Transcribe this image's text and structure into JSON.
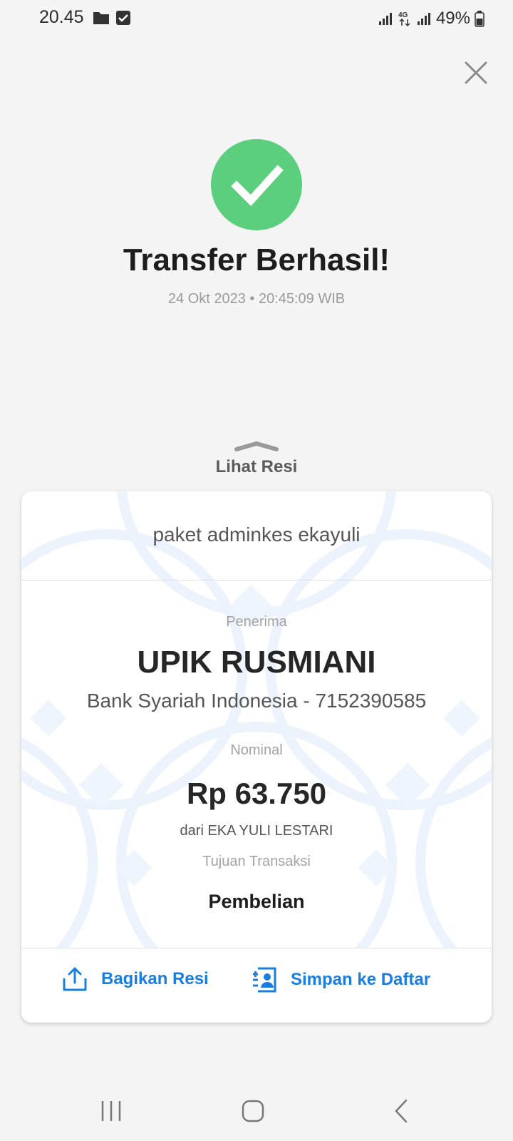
{
  "status_bar": {
    "time": "20.45",
    "battery": "49%"
  },
  "header": {
    "title": "Transfer Berhasil!",
    "datetime": "24 Okt 2023 • 20:45:09 WIB"
  },
  "receipt_toggle": {
    "label": "Lihat Resi"
  },
  "receipt": {
    "note": "paket adminkes ekayuli",
    "recipient_label": "Penerima",
    "recipient_name": "UPIK RUSMIANI",
    "recipient_bank": "Bank Syariah Indonesia - 7152390585",
    "amount_label": "Nominal",
    "amount": "Rp 63.750",
    "sender": "dari EKA YULI LESTARI",
    "purpose_label": "Tujuan Transaksi",
    "purpose": "Pembelian"
  },
  "actions": {
    "share_label": "Bagikan Resi",
    "save_label": "Simpan ke Daftar"
  },
  "colors": {
    "success": "#5ccf7e",
    "accent": "#1a7de0",
    "background": "#f4f4f5"
  },
  "icons": {
    "close": "close-icon",
    "success": "checkmark-icon",
    "share": "share-icon",
    "save": "contact-add-icon"
  }
}
